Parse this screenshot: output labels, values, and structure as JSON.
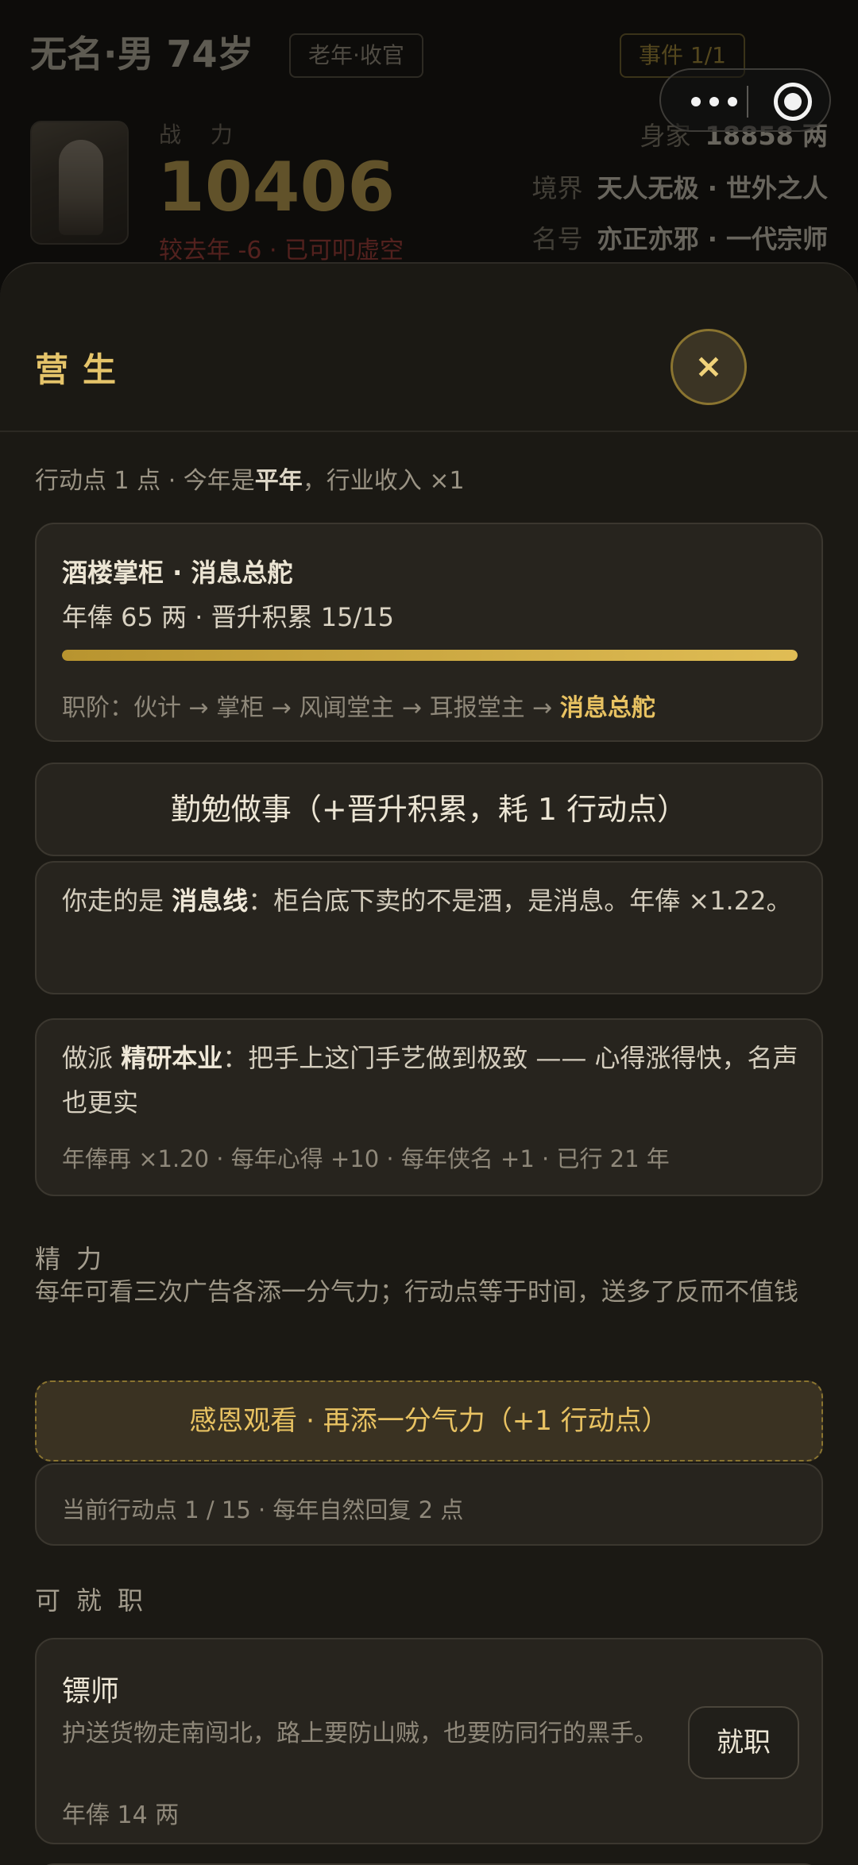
{
  "header": {
    "name": "无名·男 74岁",
    "stage_badge": "老年·收官",
    "event_badge": "事件 1/1",
    "power_label": "战 力",
    "power_value": "10406",
    "power_delta": "较去年 -6 · 已可叩虚空",
    "wealth_label": "身家",
    "wealth_value": "18858 两",
    "realm_label": "境界",
    "realm_value": "天人无极 · 世外之人",
    "title_label": "名号",
    "title_value": "亦正亦邪 · 一代宗师"
  },
  "sheet": {
    "title": "营生",
    "close_label": "×",
    "ap_prefix": "行动点 1 点 · 今年是",
    "year_type": "平年",
    "ap_suffix": "，行业收入 ×1",
    "job": {
      "name": "酒楼掌柜 · 消息总舵",
      "pay": "年俸 65 两 · 晋升积累 15/15",
      "progress": 1.0,
      "rank_prefix": "职阶：伙计 → 掌柜 → 风闻堂主 → 耳报堂主 →",
      "rank_current": "消息总舵"
    },
    "work_button": "勤勉做事（+晋升积累，耗 1 行动点）",
    "line": {
      "prefix": "你走的是",
      "name": "消息线",
      "suffix": "：柜台底下卖的不是酒，是消息。年俸 ×1.22。"
    },
    "path": {
      "prefix": "做派",
      "name": "精研本业",
      "suffix": "：把手上这门手艺做到极致 —— 心得涨得快，名声也更实",
      "stats": "年俸再 ×1.20 · 每年心得 +10 · 每年侠名 +1 · 已行 21 年"
    },
    "energy": {
      "label": "精力",
      "desc": "每年可看三次广告各添一分气力；行动点等于时间，送多了反而不值钱",
      "ad_button": "感恩观看 · 再添一分气力（+1 行动点）",
      "status": "当前行动点 1 / 15 · 每年自然回复 2 点"
    },
    "offers": {
      "label": "可就职",
      "items": [
        {
          "name": "镖师",
          "desc": "护送货物走南闯北，路上要防山贼，也要防同行的黑手。",
          "pay": "年俸 14 两",
          "button": "就职"
        }
      ]
    }
  },
  "colors": {
    "accent_gold": "#e5c46a",
    "danger_red": "#b3403a",
    "sheet_bg": "#1b1914",
    "card_bg": "#27241e"
  }
}
